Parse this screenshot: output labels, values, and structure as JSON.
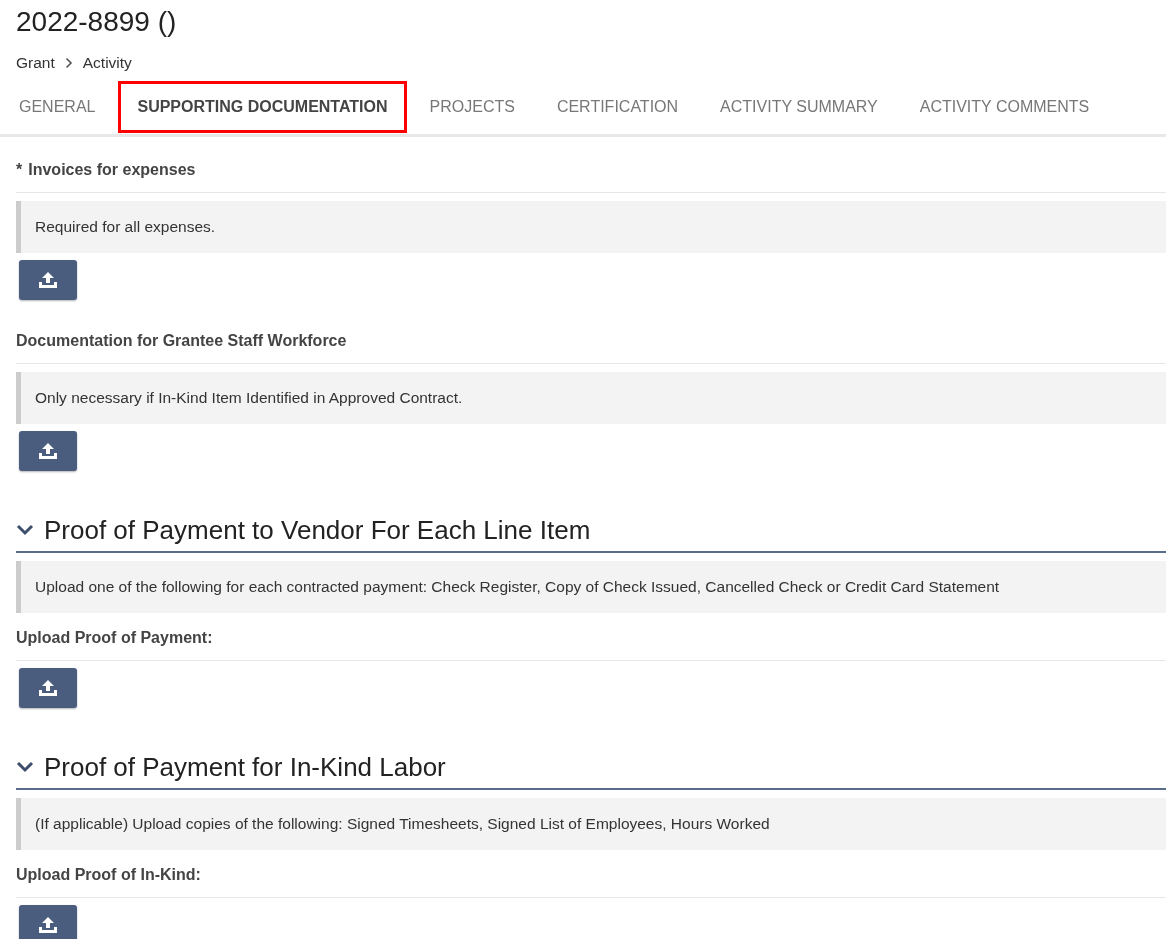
{
  "page_title": "2022-8899 ()",
  "breadcrumb": [
    "Grant",
    "Activity"
  ],
  "tabs": [
    {
      "label": "GENERAL",
      "selected": false
    },
    {
      "label": "SUPPORTING DOCUMENTATION",
      "selected": true
    },
    {
      "label": "PROJECTS",
      "selected": false
    },
    {
      "label": "CERTIFICATION",
      "selected": false
    },
    {
      "label": "ACTIVITY SUMMARY",
      "selected": false
    },
    {
      "label": "ACTIVITY COMMENTS",
      "selected": false
    }
  ],
  "items": [
    {
      "kind": "field",
      "label": "Invoices for expenses",
      "required_mark": "*",
      "note": "Required for all expenses."
    },
    {
      "kind": "field",
      "label": "Documentation for Grantee Staff Workforce",
      "note": "Only necessary if In-Kind Item Identified in Approved Contract."
    },
    {
      "kind": "heading",
      "title": "Proof of Payment to Vendor For Each Line Item",
      "expanded": true
    },
    {
      "kind": "note",
      "text": "Upload one of the following for each contracted payment: Check Register, Copy of Check Issued, Cancelled Check or Credit Card Statement"
    },
    {
      "kind": "field",
      "label": "Upload Proof of Payment:"
    },
    {
      "kind": "heading",
      "title": "Proof of Payment for In-Kind Labor",
      "expanded": true
    },
    {
      "kind": "note",
      "text": "(If applicable) Upload copies of the following: Signed Timesheets, Signed List of Employees, Hours Worked"
    },
    {
      "kind": "field",
      "label": "Upload Proof of In-Kind:"
    }
  ]
}
